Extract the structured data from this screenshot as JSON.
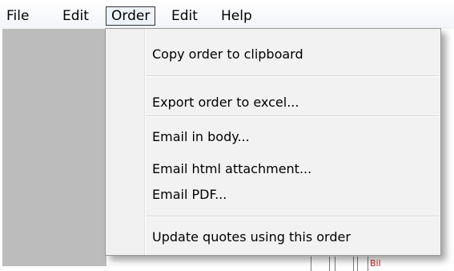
{
  "menubar": {
    "items": [
      {
        "label": "File"
      },
      {
        "label": "Edit"
      },
      {
        "label": "Order"
      },
      {
        "label": "Edit"
      },
      {
        "label": "Help"
      }
    ]
  },
  "order_menu": {
    "items": [
      {
        "label": "Copy order to clipboard"
      },
      {
        "label": "Export order to excel..."
      },
      {
        "label": "Email in body..."
      },
      {
        "label": "Email html attachment..."
      },
      {
        "label": "Email PDF..."
      },
      {
        "label": "Update quotes using this order"
      }
    ]
  },
  "background": {
    "red_cell_text": "Bil"
  },
  "colors": {
    "open_menu_highlight": "#eef3fb",
    "menu_background": "#f2f2f2",
    "app_panel": "#bcbcbc",
    "red_text": "#cc2222"
  }
}
